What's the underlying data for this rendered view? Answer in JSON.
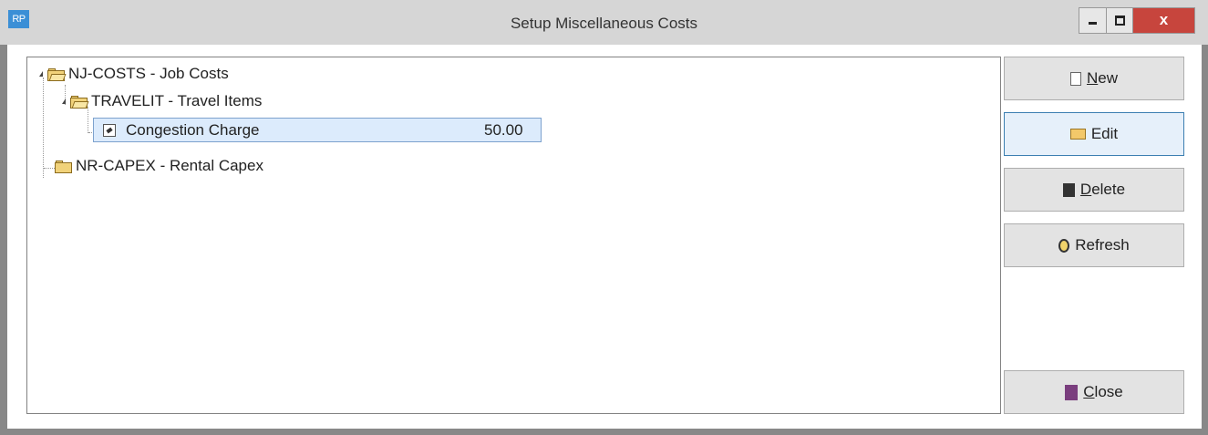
{
  "window": {
    "app_icon_text": "RP",
    "title": "Setup Miscellaneous Costs",
    "close_glyph": "x"
  },
  "tree": {
    "nodes": [
      {
        "label": "NJ-COSTS - Job Costs"
      },
      {
        "label": "TRAVELIT - Travel Items"
      },
      {
        "label": "Congestion Charge",
        "value": "50.00"
      },
      {
        "label": "NR-CAPEX - Rental Capex"
      }
    ]
  },
  "buttons": {
    "new": {
      "mnemonic": "N",
      "rest": "ew",
      "icon": "document-icon"
    },
    "edit": {
      "label": "Edit",
      "icon": "folder-open-icon"
    },
    "delete": {
      "mnemonic": "D",
      "rest": "elete",
      "icon": "trash-icon"
    },
    "refresh": {
      "label": "Refresh",
      "icon": "refresh-icon"
    },
    "close": {
      "mnemonic": "C",
      "rest": "lose",
      "icon": "exit-icon"
    }
  }
}
